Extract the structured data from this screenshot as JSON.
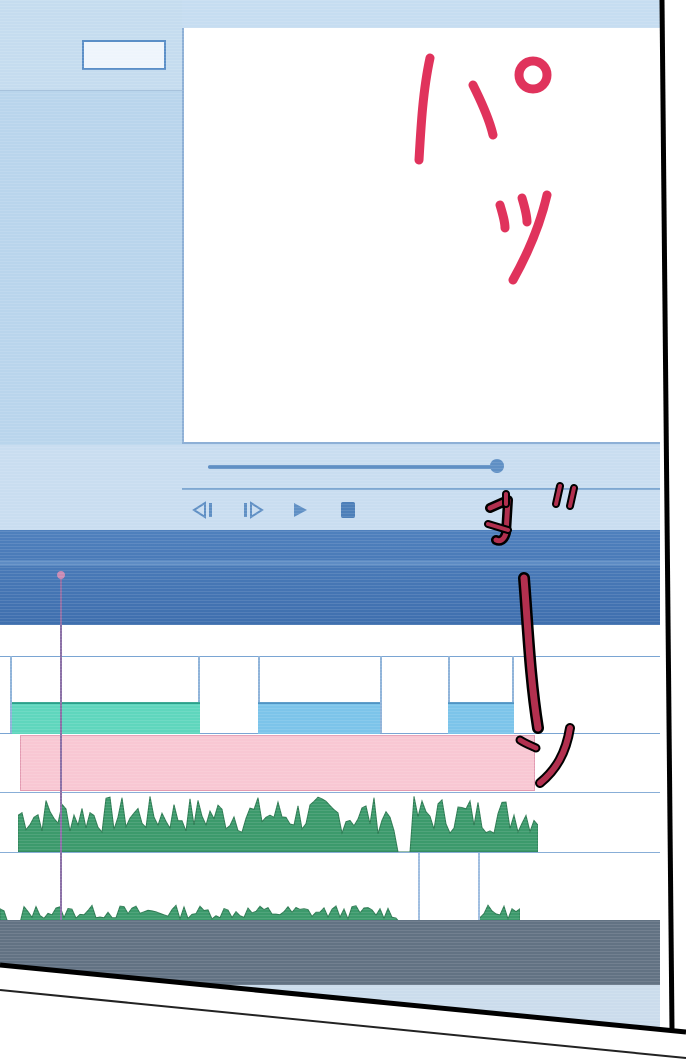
{
  "sound_effects": {
    "first": {
      "text": "パッ",
      "color": "#e0335c"
    },
    "second": {
      "text": "ヴーン",
      "color": "#b2304f"
    }
  },
  "player_controls": {
    "icons": [
      "step-back-icon",
      "step-forward-icon",
      "play-icon",
      "stop-icon"
    ]
  },
  "colors": {
    "ui_light_blue": "#b9d5ec",
    "timeline_header": "#4f80bd",
    "clip_teal": "#5fd6bd",
    "clip_blue": "#7cc4ea",
    "clip_pink": "#f8c7d3",
    "waveform_green": "#3c9a6c",
    "panel_border": "#000000"
  }
}
